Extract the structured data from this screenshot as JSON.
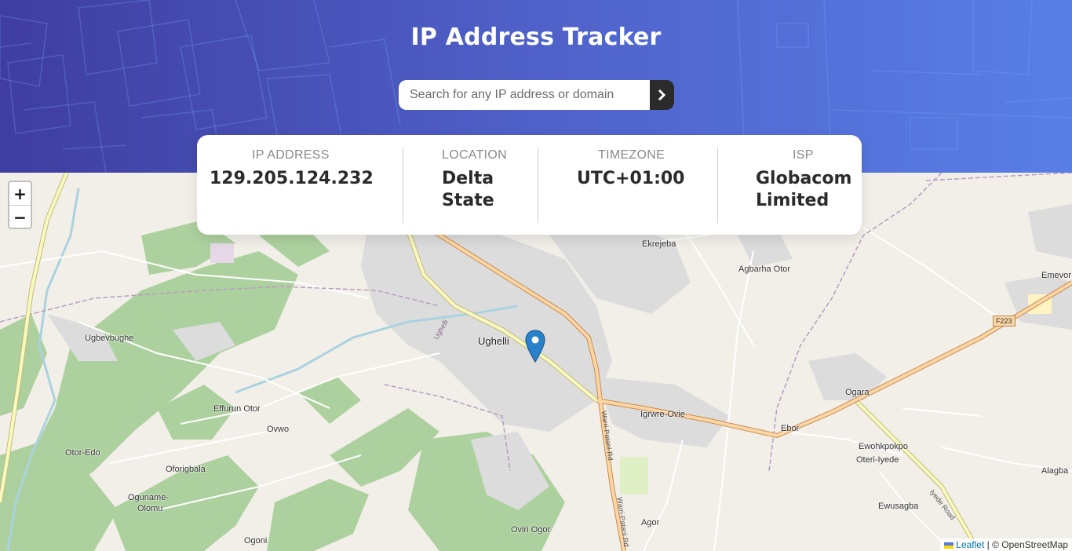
{
  "header": {
    "title": "IP Address Tracker",
    "search_placeholder": "Search for any IP address or domain",
    "search_value": "",
    "gradient_colors": [
      "#3f3d9f",
      "#587fe6"
    ]
  },
  "info": {
    "ip": {
      "label": "IP ADDRESS",
      "value": "129.205.124.232"
    },
    "location": {
      "label": "LOCATION",
      "value": "Delta State"
    },
    "timezone": {
      "label": "TIMEZONE",
      "value": "UTC+01:00"
    },
    "isp": {
      "label": "ISP",
      "value": "Globacom Limited"
    }
  },
  "map": {
    "zoom_in": "+",
    "zoom_out": "−",
    "marker_icon": "map-pin-icon",
    "attribution": {
      "flag_icon": "ukraine-flag-icon",
      "leaflet": "Leaflet",
      "separator": " | © ",
      "osm": "OpenStreetMap"
    },
    "places": {
      "ughelli": "Ughelli",
      "ekrejeba": "Ekrejeba",
      "agbarha_otor": "Agbarha Otor",
      "emevor": "Emevor",
      "ugbevbughe": "Ugbevbughe",
      "effurun_otor": "Effurun Otor",
      "ovwo": "Ovwo",
      "otor_edo": "Otor-Edo",
      "oforigbala": "Oforigbala",
      "oguname_1": "Oguname-",
      "oguname_2": "Olomu",
      "ogoni": "Ogoni",
      "oviri_ogor": "Oviri Ogor",
      "agor": "Agor",
      "igrwre_ovie": "Igrwre-Ovie",
      "ebor": "Ebor",
      "ogara": "Ogara",
      "ewohkpokpo": "Ewohkpokpo",
      "oteri_iyede": "Oteri-Iyede",
      "ewusagba": "Ewusagba",
      "alagba": "Alagba"
    },
    "roads": {
      "shield": "F223",
      "warri_patani_1": "Warri-Patani Rd",
      "warri_patani_2": "Warri-Patani Rd",
      "iyede_road": "Iyede Road",
      "ughelli_road": "Ughelli"
    }
  }
}
